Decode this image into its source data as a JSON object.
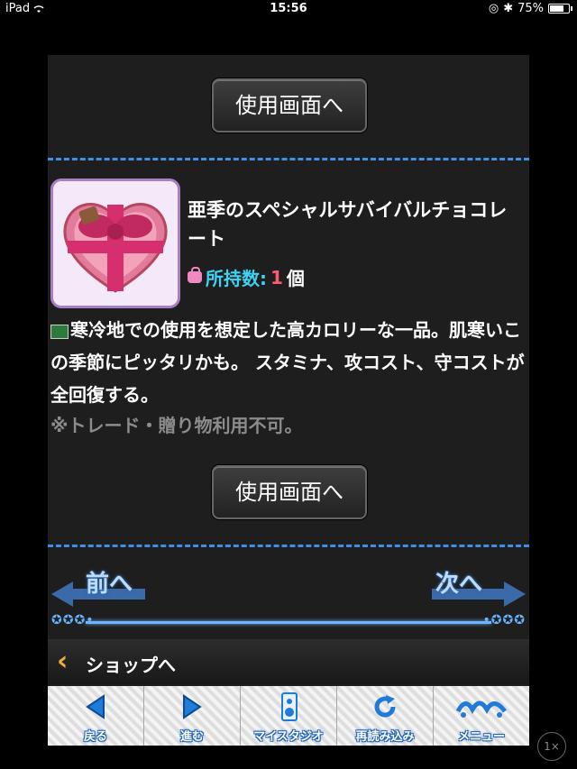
{
  "status_bar": {
    "device": "iPad",
    "time": "15:56",
    "battery": "75%"
  },
  "use_screen_button": "使用画面へ",
  "item": {
    "name": "亜季のスペシャルサバイバルチョコレート",
    "owned_label": "所持数:",
    "owned_count": "1",
    "owned_unit": "個",
    "description": "寒冷地での使用を想定した高カロリーな一品。肌寒いこの季節にピッタリかも。 スタミナ、攻コスト、守コストが全回復する。",
    "note": "※トレード・贈り物利用不可。"
  },
  "nav": {
    "prev": "前へ",
    "next": "次へ"
  },
  "shop_back": "ショップへ",
  "bottom_bar": [
    {
      "label": "戻る",
      "icon": "back-arrow-icon"
    },
    {
      "label": "進む",
      "icon": "forward-arrow-icon"
    },
    {
      "label": "マイスタジオ",
      "icon": "speaker-icon"
    },
    {
      "label": "再読み込み",
      "icon": "reload-icon"
    },
    {
      "label": "メニュー",
      "icon": "menu-logo-icon"
    }
  ],
  "zoom": "1×",
  "colors": {
    "accent_blue": "#3f8fe6",
    "owned_label": "#3fd2f2",
    "owned_count": "#ff5a6e"
  }
}
